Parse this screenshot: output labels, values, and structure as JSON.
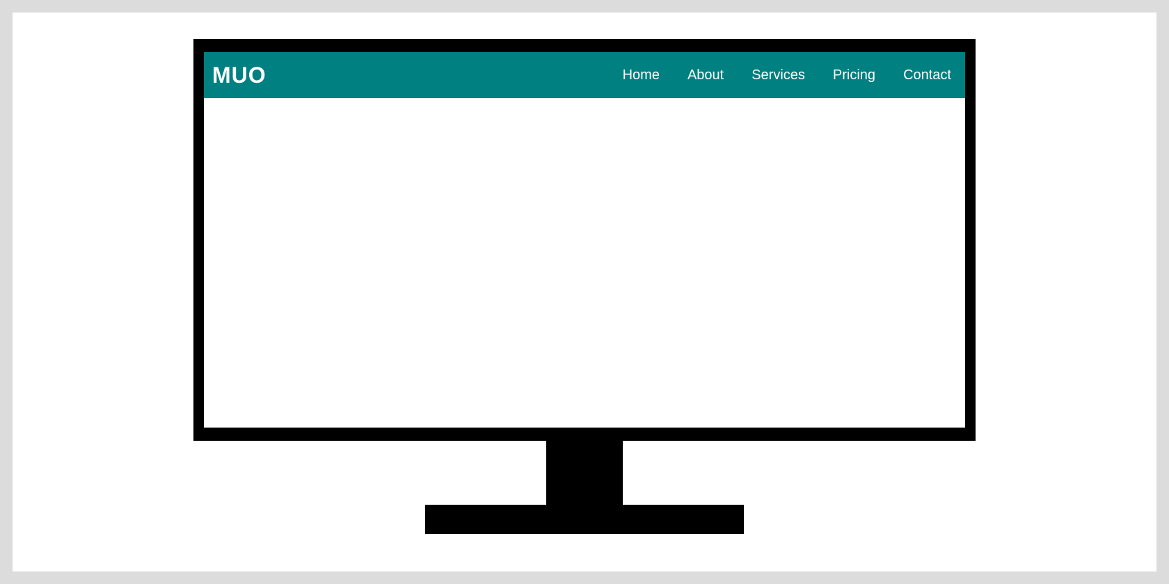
{
  "colors": {
    "page_bg": "#dcdcdc",
    "canvas_bg": "#ffffff",
    "monitor_black": "#000000",
    "navbar_bg": "#008080",
    "navbar_text": "#ffffff"
  },
  "navbar": {
    "brand": "MUO",
    "links": [
      {
        "label": "Home"
      },
      {
        "label": "About"
      },
      {
        "label": "Services"
      },
      {
        "label": "Pricing"
      },
      {
        "label": "Contact"
      }
    ]
  }
}
